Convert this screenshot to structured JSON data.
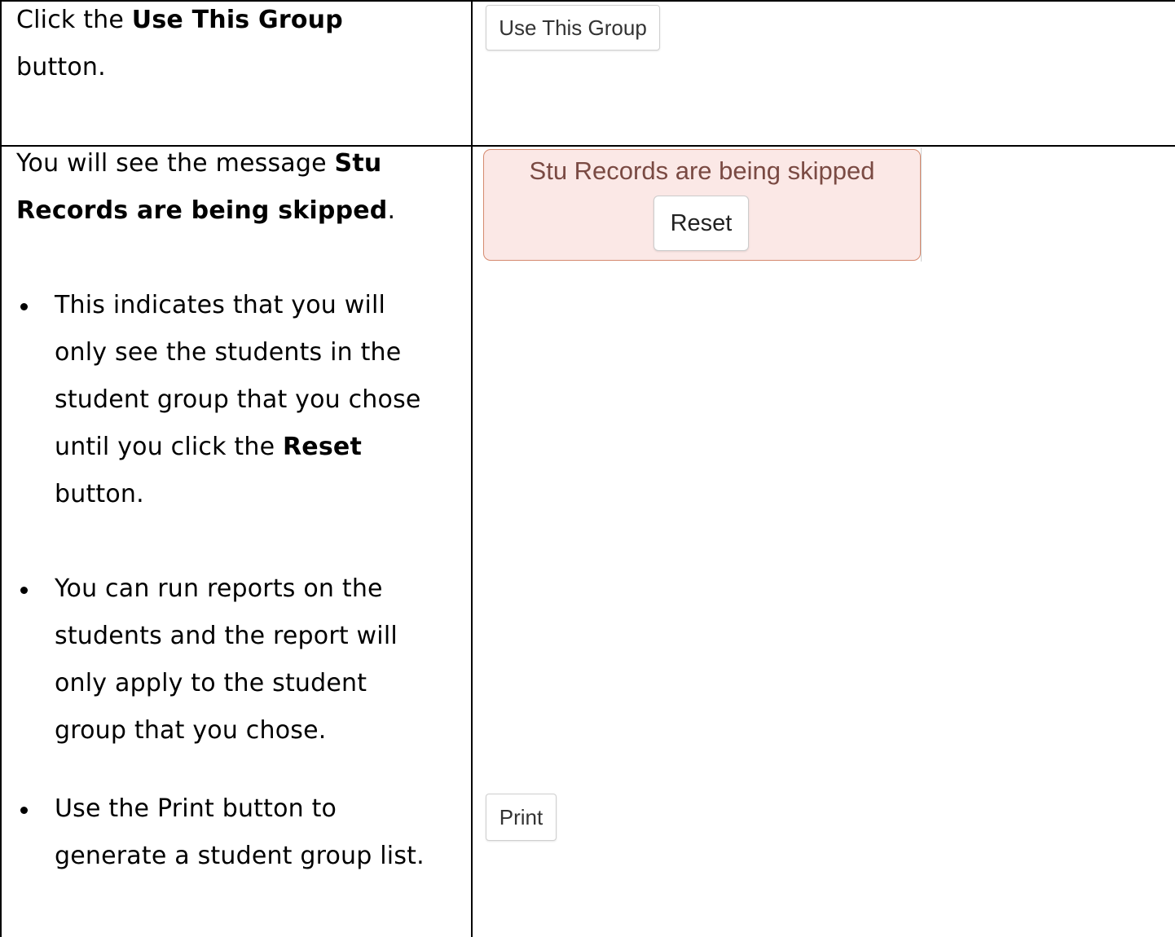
{
  "row1": {
    "instruction_prefix": "Click the ",
    "instruction_bold": "Use This Group",
    "instruction_suffix": "button.",
    "button_label": "Use This Group"
  },
  "row2": {
    "message_prefix": "You will see the message ",
    "message_bold_1": "Stu",
    "message_bold_2": "Records are being skipped",
    "message_suffix": ".",
    "bullet1": {
      "line1": "This indicates that you will",
      "line2": "only see the students in the",
      "line3": "student group that you chose",
      "line4_prefix": "until you click the ",
      "line4_bold": "Reset",
      "line5": "button."
    },
    "bullet2": {
      "line1": "You can run reports on the",
      "line2": "students and the report will",
      "line3": "only apply to the student",
      "line4": "group that you chose."
    },
    "bullet3": {
      "line1": "Use the Print button to",
      "line2": "generate a student group list."
    },
    "alert": {
      "message": "Stu Records are being skipped",
      "reset_label": "Reset",
      "background_color": "#fbe8e6",
      "border_color": "#d58a6f",
      "text_color": "#7a4a43"
    },
    "print_label": "Print"
  }
}
